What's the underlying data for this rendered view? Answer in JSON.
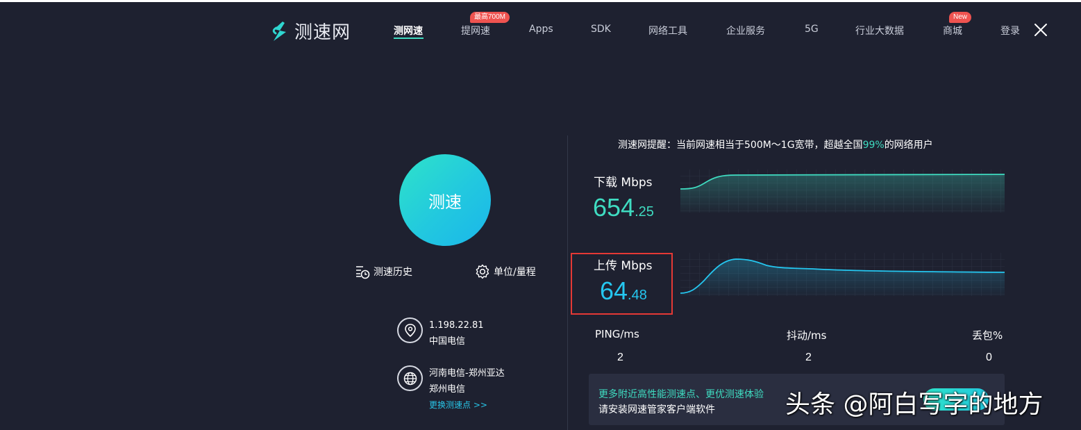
{
  "colors": {
    "background": "#1e2130",
    "accent_teal": "#3fdcc1",
    "accent_blue": "#25c7f0",
    "badge_red": "#ef5350",
    "highlight_box": "#e53935"
  },
  "header": {
    "logo_text": "测速网",
    "logo_icon": "lightning-s-icon",
    "nav": [
      {
        "label": "测网速",
        "active": true
      },
      {
        "label": "提网速",
        "badge": "最高700M"
      },
      {
        "label": "Apps"
      },
      {
        "label": "SDK"
      },
      {
        "label": "网络工具"
      },
      {
        "label": "企业服务"
      },
      {
        "label": "5G"
      },
      {
        "label": "行业大数据"
      },
      {
        "label": "商城",
        "badge": "New"
      },
      {
        "label": "登录"
      }
    ],
    "close_icon": "close-icon"
  },
  "left": {
    "start_button": "测速",
    "history_label": "测速历史",
    "settings_label": "单位/量程",
    "client": {
      "ip": "1.198.22.81",
      "isp": "中国电信"
    },
    "server": {
      "name": "河南电信-郑州亚达",
      "isp": "郑州电信",
      "change_link": "更换测速点 >>"
    }
  },
  "right": {
    "notice_prefix": "测速网提醒：当前网速相当于500M～1G宽带，超越全国",
    "notice_percent": "99%",
    "notice_suffix": "的网络用户",
    "download": {
      "label": "下载 Mbps",
      "int": "654",
      "dec": ".25",
      "value": 654.25
    },
    "upload": {
      "label": "上传 Mbps",
      "int": "64",
      "dec": ".48",
      "value": 64.48
    },
    "stats": [
      {
        "label": "PING/ms",
        "value": "2"
      },
      {
        "label": "抖动/ms",
        "value": "2"
      },
      {
        "label": "丢包%",
        "value": "0"
      }
    ],
    "promo": {
      "line1": "更多附近高性能测速点、更优测速体验",
      "line2": "请安装网速管家客户端软件"
    }
  },
  "watermark": "头条 @阿白写字的地方"
}
